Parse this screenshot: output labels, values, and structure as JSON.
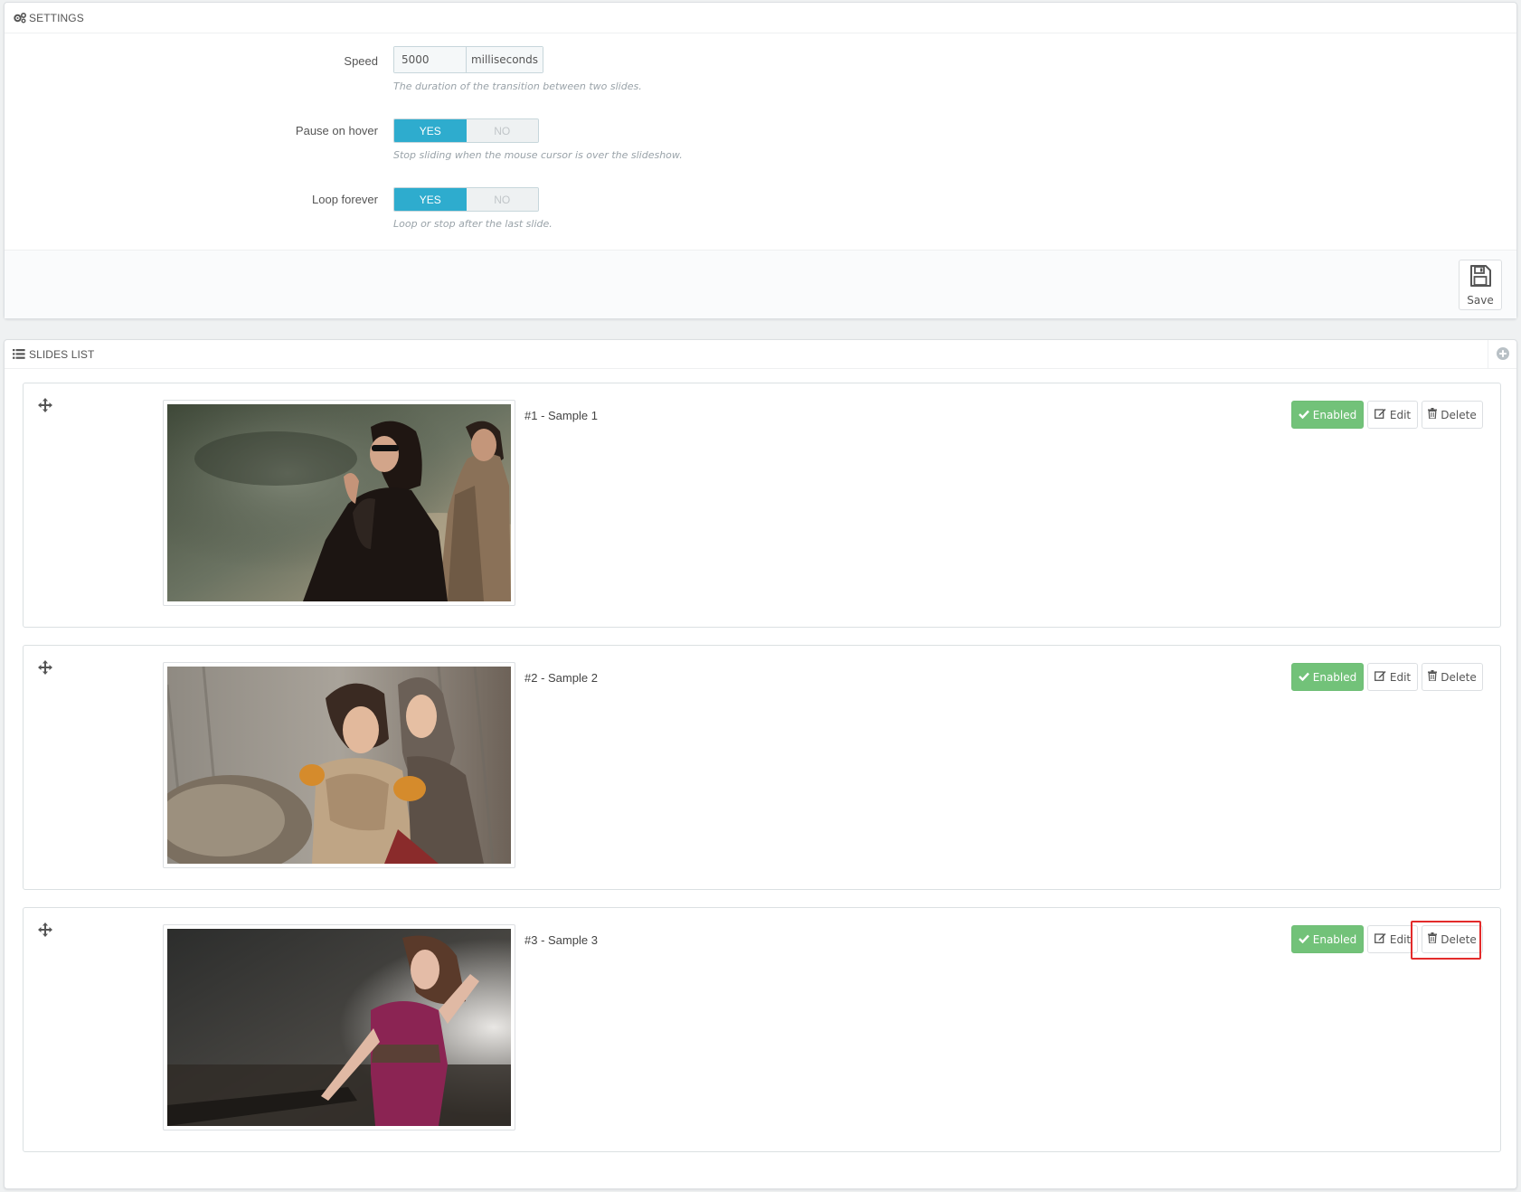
{
  "settings": {
    "heading": "SETTINGS",
    "speed": {
      "label": "Speed",
      "value": "5000",
      "unit": "milliseconds",
      "hint": "The duration of the transition between two slides."
    },
    "pause_on_hover": {
      "label": "Pause on hover",
      "yes": "YES",
      "no": "NO",
      "selected": "YES",
      "hint": "Stop sliding when the mouse cursor is over the slideshow."
    },
    "loop_forever": {
      "label": "Loop forever",
      "yes": "YES",
      "no": "NO",
      "selected": "YES",
      "hint": "Loop or stop after the last slide."
    },
    "save_label": "Save"
  },
  "slides_list": {
    "heading": "SLIDES LIST",
    "slides": [
      {
        "title": "#1 - Sample 1",
        "status": "Enabled",
        "edit": "Edit",
        "delete": "Delete"
      },
      {
        "title": "#2 - Sample 2",
        "status": "Enabled",
        "edit": "Edit",
        "delete": "Delete"
      },
      {
        "title": "#3 - Sample 3",
        "status": "Enabled",
        "edit": "Edit",
        "delete": "Delete"
      }
    ]
  },
  "colors": {
    "switch_on": "#2eacce",
    "enabled_button": "#72c279",
    "highlight": "#e32b2b"
  },
  "icons": [
    "cogs-icon",
    "list-icon",
    "plus-circle-icon",
    "save-icon",
    "move-icon",
    "check-icon",
    "edit-icon",
    "trash-icon"
  ]
}
